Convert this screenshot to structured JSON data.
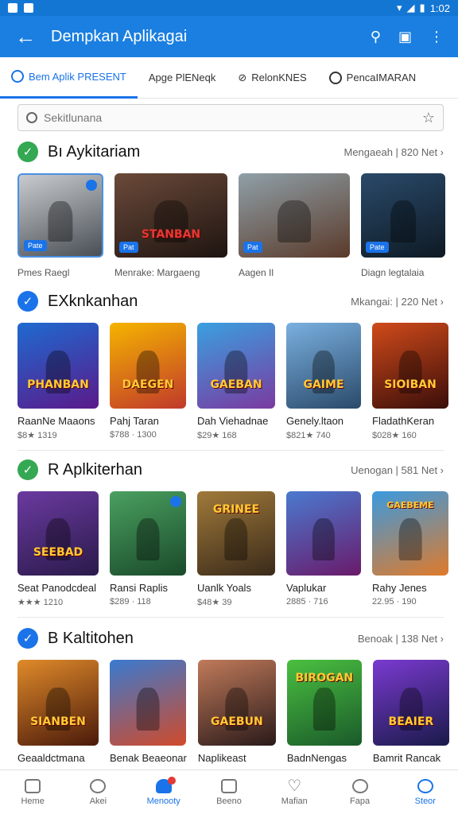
{
  "status": {
    "right_text": "1:02"
  },
  "appbar": {
    "title": "Dempkan Aplikagai"
  },
  "tabs": [
    {
      "label": "Bem Aplik PRESENT",
      "active": true
    },
    {
      "label": "Apge PlENeqk",
      "active": false
    },
    {
      "label": "RelonKNES",
      "active": false
    },
    {
      "label": "PencaIMARAN",
      "active": false
    }
  ],
  "search": {
    "placeholder": "Sekitlunana"
  },
  "sections": [
    {
      "title": "Bı Aykitariam",
      "more": "Mengaeah | 820  Net ›",
      "check_color": "#34a853",
      "items": [
        {
          "caption": "Pmes Raegl",
          "badge": "Pate"
        },
        {
          "caption": "Menrake: Margaeng",
          "badge": "Pat"
        },
        {
          "caption": "Aagen Il",
          "badge": "Pat"
        },
        {
          "caption": "Diagn legtalaia",
          "badge": "Pate"
        }
      ]
    },
    {
      "title": "EXknkanhan",
      "more": "Mkangai: | 220  Net ›",
      "check_color": "#1a73e8",
      "items": [
        {
          "caption": "RaanNe Maaons",
          "sub": "$8★ 1319",
          "logo": "PHANBAN"
        },
        {
          "caption": "Pahj Taran",
          "sub": "$788 · 1300",
          "logo": "DAEGEN"
        },
        {
          "caption": "Dah Viehadnae",
          "sub": "$29★ 168",
          "logo": "GAEBAN"
        },
        {
          "caption": "Genely.ltaon",
          "sub": "$821★ 740",
          "logo": "GAIME"
        },
        {
          "caption": "FladathKeran",
          "sub": "$028★ 160",
          "logo": "SIOIBAN"
        }
      ]
    },
    {
      "title": "R Aplkiterhan",
      "more": "Uenogan | 581  Net ›",
      "check_color": "#34a853",
      "items": [
        {
          "caption": "Seat Panodcdeal",
          "sub": "★★★ 1210",
          "logo": "SEEBAD"
        },
        {
          "caption": "Ransi Raplis",
          "sub": "$289 · 118",
          "logo": ""
        },
        {
          "caption": "Uanlk Yoals",
          "sub": "$48★ 39",
          "logo": "GRINEE"
        },
        {
          "caption": "Vaplukar",
          "sub": "2885 · 716",
          "logo": ""
        },
        {
          "caption": "Rahy Jenes",
          "sub": "22.95 · 190",
          "logo": "GAEBEME"
        }
      ]
    },
    {
      "title": "B Kaltitohen",
      "more": "Benoak | 138  Net ›",
      "check_color": "#1a73e8",
      "items": [
        {
          "caption": "Geaaldctmana",
          "sub": "",
          "logo": "SIANBEN"
        },
        {
          "caption": "Benak Beaeonar",
          "sub": "",
          "logo": ""
        },
        {
          "caption": "Naplikeast",
          "sub": "",
          "logo": "GAEBUN"
        },
        {
          "caption": "BadnNengas",
          "sub": "",
          "logo": "BIROGAN"
        },
        {
          "caption": "Bamrit Rancak",
          "sub": "",
          "logo": "BEAIER"
        }
      ]
    }
  ],
  "nav": [
    {
      "label": "Heme",
      "active": false
    },
    {
      "label": "Akei",
      "active": false
    },
    {
      "label": "Menooty",
      "active": true
    },
    {
      "label": "Beeno",
      "active": false
    },
    {
      "label": "Mafian",
      "active": false
    },
    {
      "label": "Fapa",
      "active": false
    },
    {
      "label": "Steor",
      "active": false
    }
  ],
  "colors": {
    "primary": "#1a73e8",
    "appbar": "#1a7fe0"
  }
}
